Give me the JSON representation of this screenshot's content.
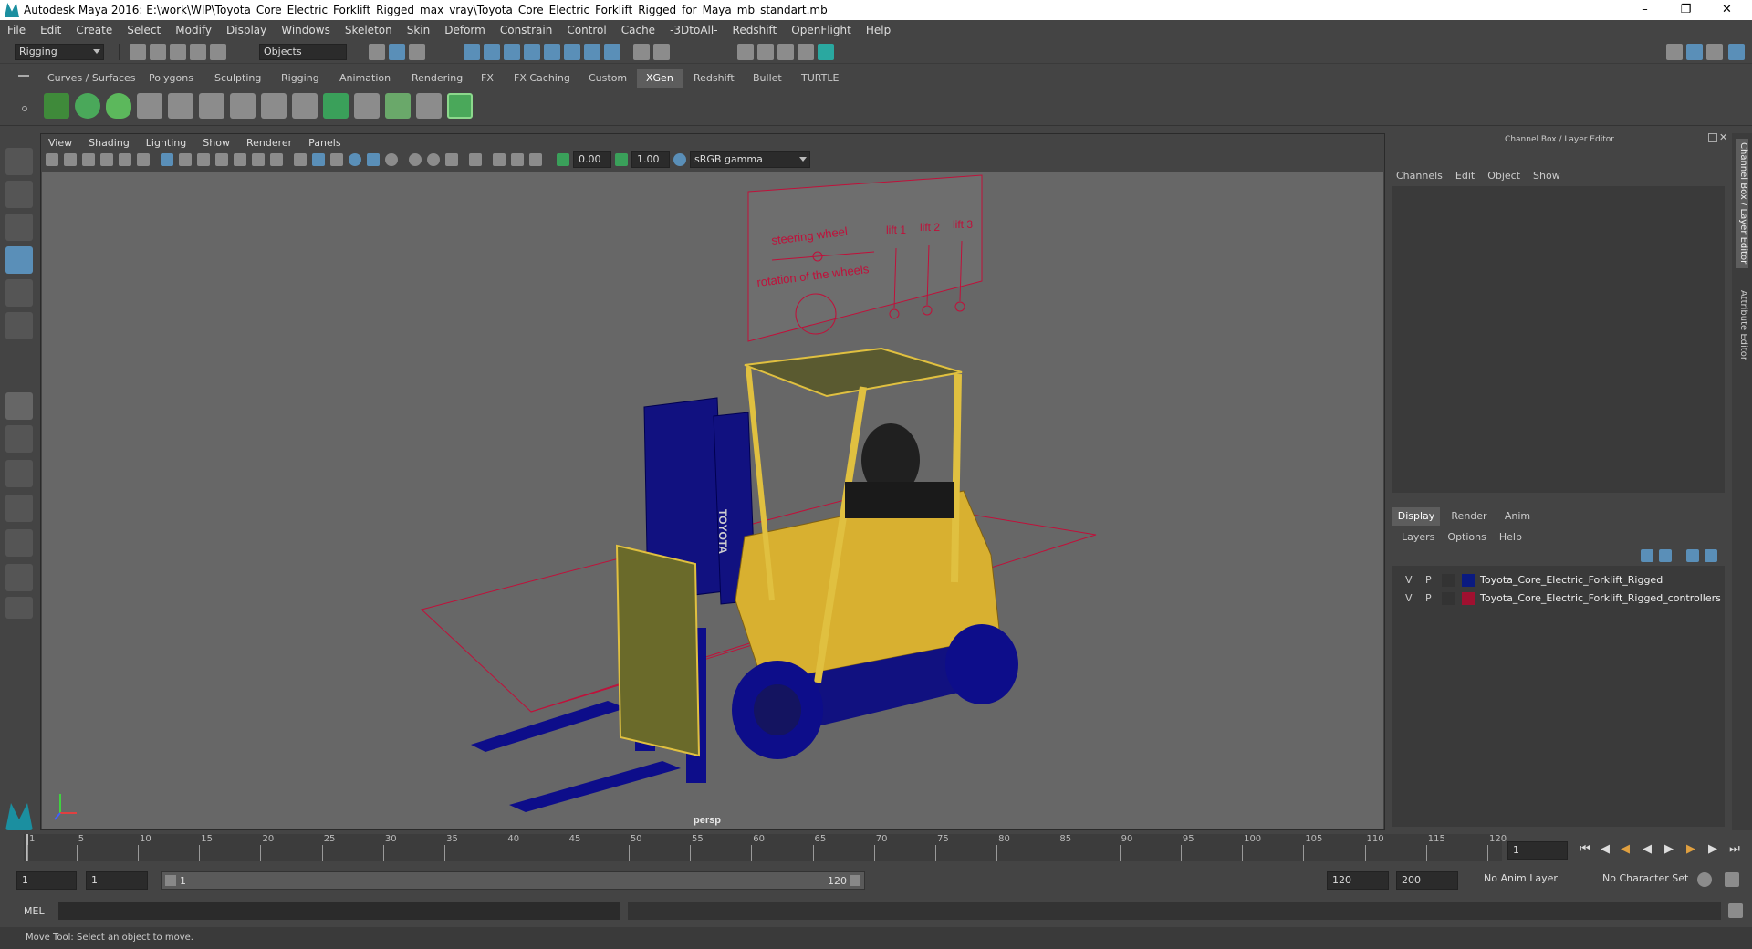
{
  "window": {
    "title": "Autodesk Maya 2016: E:\\work\\WIP\\Toyota_Core_Electric_Forklift_Rigged_max_vray\\Toyota_Core_Electric_Forklift_Rigged_for_Maya_mb_standart.mb"
  },
  "menu": [
    "File",
    "Edit",
    "Create",
    "Select",
    "Modify",
    "Display",
    "Windows",
    "Skeleton",
    "Skin",
    "Deform",
    "Constrain",
    "Control",
    "Cache",
    "-3DtoAll-",
    "Redshift",
    "OpenFlight",
    "Help"
  ],
  "status": {
    "mode": "Rigging",
    "select_mode": "Objects"
  },
  "shelf_tabs": [
    "Curves / Surfaces",
    "Polygons",
    "Sculpting",
    "Rigging",
    "Animation",
    "Rendering",
    "FX",
    "FX Caching",
    "Custom",
    "XGen",
    "Redshift",
    "Bullet",
    "TURTLE"
  ],
  "shelf_active": "XGen",
  "viewport": {
    "menu": [
      "View",
      "Shading",
      "Lighting",
      "Show",
      "Renderer",
      "Panels"
    ],
    "exposure": "0.00",
    "gamma": "1.00",
    "color_space": "sRGB gamma",
    "camera": "persp",
    "rig_board": {
      "title": "steering wheel",
      "subtitle": "rotation of the wheels",
      "labels": [
        "lift 1",
        "lift 2",
        "lift 3"
      ]
    },
    "brand": "TOYOTA"
  },
  "channel_box": {
    "title": "Channel Box / Layer Editor",
    "menu": [
      "Channels",
      "Edit",
      "Object",
      "Show"
    ],
    "tabs": [
      "Display",
      "Render",
      "Anim"
    ],
    "active_tab": "Display",
    "layer_menu": [
      "Layers",
      "Options",
      "Help"
    ],
    "layers": [
      {
        "v": "V",
        "p": "P",
        "color": "#0a1a80",
        "name": "Toyota_Core_Electric_Forklift_Rigged"
      },
      {
        "v": "V",
        "p": "P",
        "color": "#a01030",
        "name": "Toyota_Core_Electric_Forklift_Rigged_controllers"
      }
    ]
  },
  "side_tabs": [
    "Channel Box / Layer Editor",
    "Attribute Editor"
  ],
  "timeline": {
    "ticks": [
      "1",
      "5",
      "10",
      "15",
      "20",
      "25",
      "30",
      "35",
      "40",
      "45",
      "50",
      "55",
      "60",
      "65",
      "70",
      "75",
      "80",
      "85",
      "90",
      "95",
      "100",
      "105",
      "110",
      "115",
      "120"
    ],
    "current_frame": "1"
  },
  "range": {
    "start": "1",
    "anim_start": "1",
    "slider_start": "1",
    "slider_end": "120",
    "end": "120",
    "anim_end": "200",
    "anim_layer": "No Anim Layer",
    "char_set": "No Character Set"
  },
  "command": {
    "label": "MEL"
  },
  "help_line": "Move Tool: Select an object to move."
}
